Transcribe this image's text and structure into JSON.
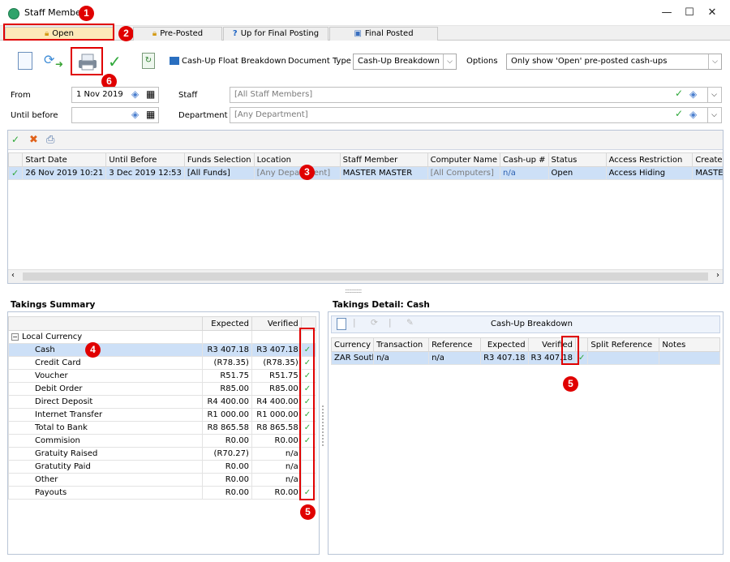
{
  "window": {
    "title": "Staff Member",
    "minimize": "—",
    "maximize": "☐",
    "close": "✕"
  },
  "badges": {
    "b1": "1",
    "b2": "2",
    "b3": "3",
    "b4": "4",
    "b5a": "5",
    "b5b": "5",
    "b6": "6"
  },
  "tabs": [
    {
      "label": "Open",
      "icon": "lock-icon"
    },
    {
      "label": "Pre-Posted",
      "icon": "lock-icon"
    },
    {
      "label": "Up for Final Posting",
      "icon": "question-icon"
    },
    {
      "label": "Final Posted",
      "icon": "posted-icon"
    }
  ],
  "toolbar": {
    "float_label": "Cash-Up Float Breakdown",
    "doc_type_label": "Document Type",
    "doc_type_value": "Cash-Up Breakdown",
    "options_label": "Options",
    "options_value": "Only show 'Open' pre-posted cash-ups"
  },
  "filters": {
    "from_label": "From",
    "from_value": "1 Nov 2019",
    "until_label": "Until before",
    "until_value": "",
    "staff_label": "Staff",
    "staff_value": "[All Staff Members]",
    "dept_label": "Department",
    "dept_value": "[Any Department]"
  },
  "main_grid": {
    "columns": [
      "Start Date",
      "Until Before",
      "Funds Selection",
      "Location",
      "Staff Member",
      "Computer Name",
      "Cash-up #",
      "Status",
      "Access Restriction",
      "Created"
    ],
    "rows": [
      [
        "26 Nov 2019 10:21",
        "3 Dec 2019 12:53",
        "[All Funds]",
        "[Any Department]",
        "MASTER MASTER",
        "[All Computers]",
        "n/a",
        "Open",
        "Access Hiding",
        "MASTER"
      ]
    ]
  },
  "splitter_dots": "::::::::::::",
  "takings_summary": {
    "title": "Takings Summary",
    "columns": [
      "",
      "Expected",
      "Verified",
      ""
    ],
    "group": "Local Currency",
    "rows": [
      {
        "name": "Cash",
        "expected": "R3 407.18",
        "verified": "R3 407.18",
        "check": "✓"
      },
      {
        "name": "Credit Card",
        "expected": "(R78.35)",
        "verified": "(R78.35)",
        "check": "✓"
      },
      {
        "name": "Voucher",
        "expected": "R51.75",
        "verified": "R51.75",
        "check": "✓"
      },
      {
        "name": "Debit Order",
        "expected": "R85.00",
        "verified": "R85.00",
        "check": "✓"
      },
      {
        "name": "Direct Deposit",
        "expected": "R4 400.00",
        "verified": "R4 400.00",
        "check": "✓"
      },
      {
        "name": "Internet Transfer",
        "expected": "R1 000.00",
        "verified": "R1 000.00",
        "check": "✓"
      },
      {
        "name": "Total to Bank",
        "expected": "R8 865.58",
        "verified": "R8 865.58",
        "check": "✓"
      },
      {
        "name": "Commision",
        "expected": "R0.00",
        "verified": "R0.00",
        "check": "✓"
      },
      {
        "name": "Gratuity Raised",
        "expected": "(R70.27)",
        "verified": "n/a",
        "check": ""
      },
      {
        "name": "Gratutity Paid",
        "expected": "R0.00",
        "verified": "n/a",
        "check": ""
      },
      {
        "name": "Other",
        "expected": "R0.00",
        "verified": "n/a",
        "check": ""
      },
      {
        "name": "Payouts",
        "expected": "R0.00",
        "verified": "R0.00",
        "check": "✓"
      }
    ]
  },
  "takings_detail": {
    "title": "Takings Detail: Cash",
    "toolbar_label": "Cash-Up Breakdown",
    "columns": [
      "Currency",
      "Transaction",
      "Reference",
      "Expected",
      "Verified",
      "",
      "Split Reference",
      "Notes"
    ],
    "rows": [
      {
        "currency": "ZAR South",
        "transaction": "n/a",
        "reference": "n/a",
        "expected": "R3 407.18",
        "verified": "R3 407.18",
        "check": "✓",
        "split": "",
        "notes": ""
      }
    ]
  },
  "colors": {
    "accent_red": "#e00000",
    "check_green": "#2fa83a",
    "selection": "#cde0f7"
  }
}
